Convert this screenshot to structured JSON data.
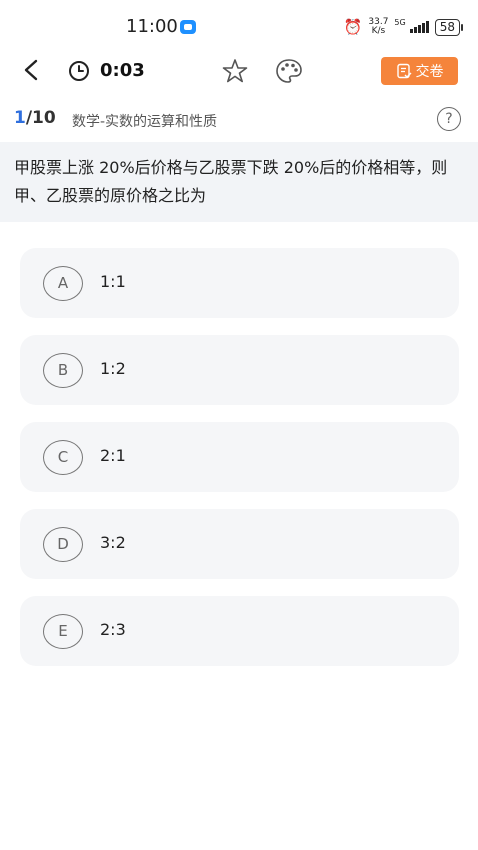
{
  "status": {
    "time": "11:00",
    "net_speed_value": "33.7",
    "net_speed_unit": "K/s",
    "network": "5G",
    "battery": "58"
  },
  "toolbar": {
    "timer": "0:03",
    "submit_label": "交卷",
    "accent_color": "#f5843b"
  },
  "question": {
    "current": "1",
    "total": "/10",
    "category": "数学-实数的运算和性质",
    "text": "甲股票上涨 20%后价格与乙股票下跌 20%后的价格相等，则甲、乙股票的原价格之比为"
  },
  "options": [
    {
      "letter": "A",
      "text": "1:1"
    },
    {
      "letter": "B",
      "text": "1:2"
    },
    {
      "letter": "C",
      "text": "2:1"
    },
    {
      "letter": "D",
      "text": "3:2"
    },
    {
      "letter": "E",
      "text": "2:3"
    }
  ]
}
